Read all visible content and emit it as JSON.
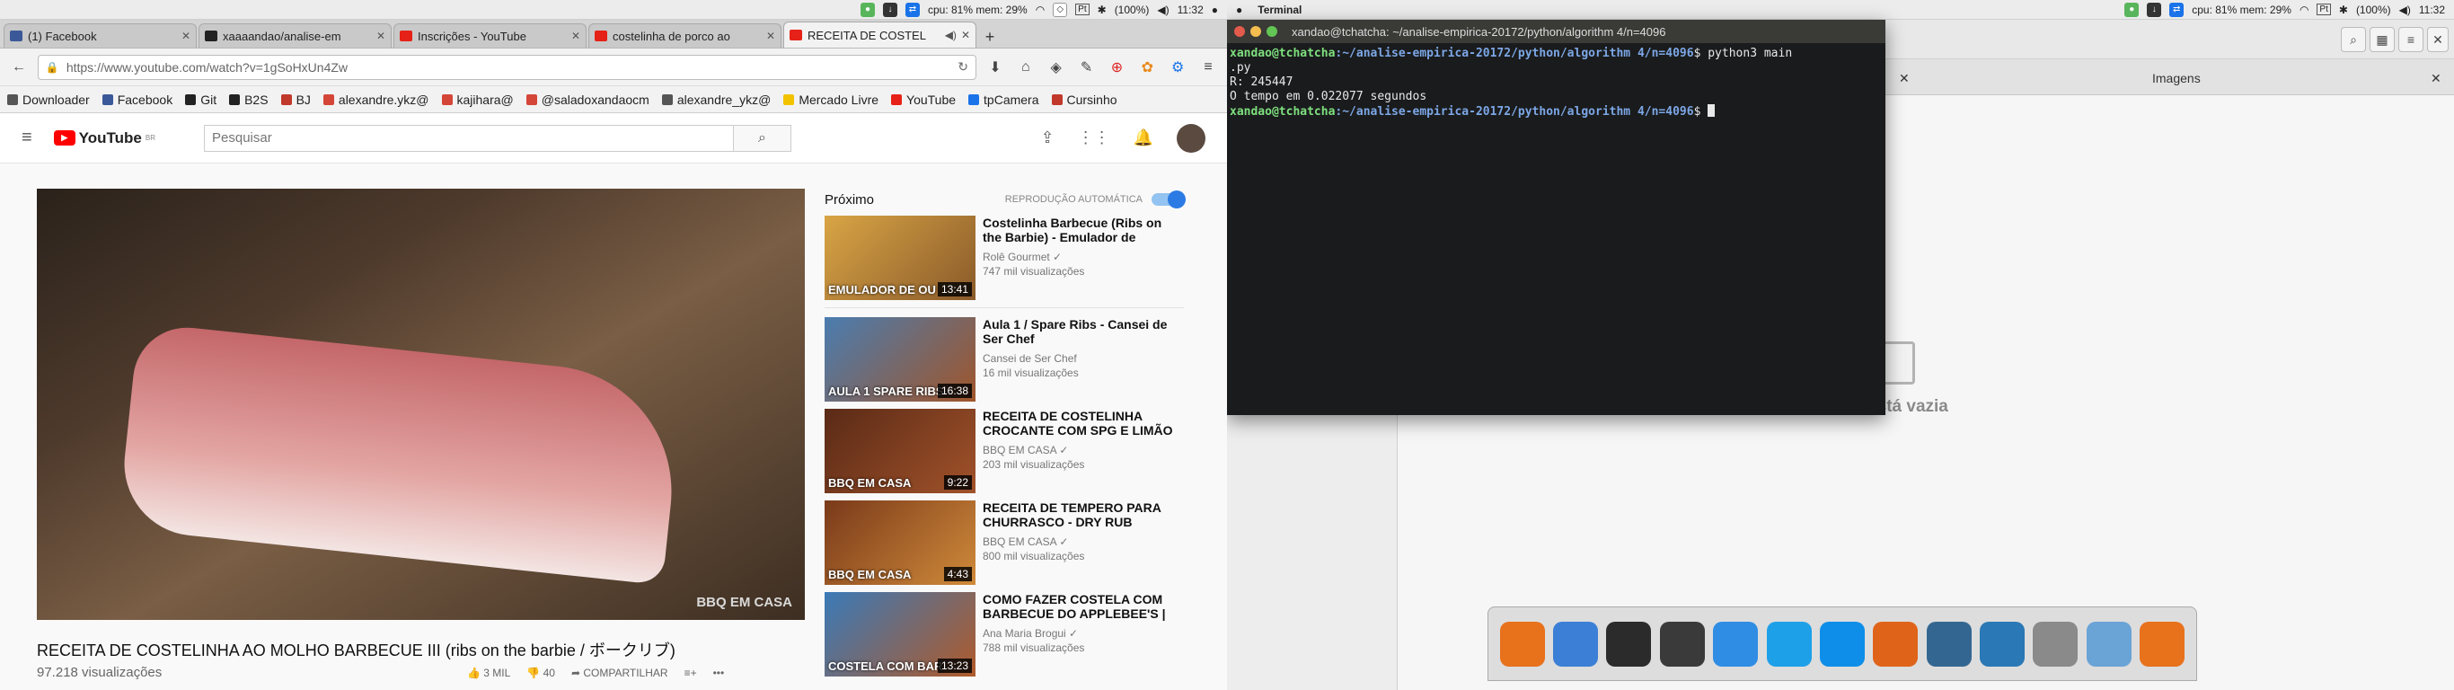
{
  "left": {
    "menubar": {
      "cpu_mem": "cpu: 81% mem: 29%",
      "battery": "(100%)",
      "clock": "11:32"
    },
    "tabs": [
      {
        "label": "(1) Facebook",
        "color": "#3b5998"
      },
      {
        "label": "xaaaandao/analise-em",
        "color": "#222222"
      },
      {
        "label": "Inscrições - YouTube",
        "color": "#e62117"
      },
      {
        "label": "costelinha de porco ao",
        "color": "#e62117"
      },
      {
        "label": "RECEITA DE COSTEL",
        "color": "#e62117"
      }
    ],
    "url": "https://www.youtube.com/watch?v=1gSoHxUn4Zw",
    "bookmarks": [
      {
        "label": "Downloader",
        "color": "#555555"
      },
      {
        "label": "Facebook",
        "color": "#3b5998"
      },
      {
        "label": "Git",
        "color": "#222222"
      },
      {
        "label": "B2S",
        "color": "#222222"
      },
      {
        "label": "BJ",
        "color": "#c0392b"
      },
      {
        "label": "alexandre.ykz@",
        "color": "#d44638"
      },
      {
        "label": "kajihara@",
        "color": "#d44638"
      },
      {
        "label": "@saladoxandaocm",
        "color": "#d44638"
      },
      {
        "label": "alexandre_ykz@",
        "color": "#555555"
      },
      {
        "label": "Mercado Livre",
        "color": "#f2c200"
      },
      {
        "label": "YouTube",
        "color": "#e62117"
      },
      {
        "label": "tpCamera",
        "color": "#1a73e8"
      },
      {
        "label": "Cursinho",
        "color": "#c0392b"
      }
    ],
    "youtube": {
      "search_placeholder": "Pesquisar",
      "video_title": "RECEITA DE COSTELINHA AO MOLHO BARBECUE III (ribs on the barbie / ボークリブ)",
      "views": "97.218 visualizações",
      "watermark": "BBQ EM CASA",
      "likes": "3 MIL",
      "dislikes": "40",
      "share": "COMPARTILHAR",
      "up_next": "Próximo",
      "autoplay": "REPRODUÇÃO AUTOMÁTICA",
      "related": [
        {
          "title": "Costelinha Barbecue (Ribs on the Barbie) - Emulador de",
          "channel": "Rolê Gourmet ✓",
          "views": "747 mil visualizações",
          "duration": "13:41",
          "thumb_text": "EMULADOR DE OU",
          "c1": "#d9a545",
          "c2": "#8a5a2a"
        },
        {
          "title": "Aula 1 / Spare Ribs - Cansei de Ser Chef",
          "channel": "Cansei de Ser Chef",
          "views": "16 mil visualizações",
          "duration": "16:38",
          "thumb_text": "AULA 1 SPARE RIBS",
          "c1": "#4a7db0",
          "c2": "#a0552a"
        },
        {
          "title": "RECEITA DE COSTELINHA CROCANTE COM SPG E LIMÃO",
          "channel": "BBQ EM CASA ✓",
          "views": "203 mil visualizações",
          "duration": "9:22",
          "thumb_text": "BBQ EM CASA",
          "c1": "#5a2a16",
          "c2": "#a1522a"
        },
        {
          "title": "RECEITA DE TEMPERO PARA CHURRASCO - DRY RUB",
          "channel": "BBQ EM CASA ✓",
          "views": "800 mil visualizações",
          "duration": "4:43",
          "thumb_text": "BBQ EM CASA",
          "c1": "#7a3a1a",
          "c2": "#d08a3a"
        },
        {
          "title": "COMO FAZER COSTELA COM BARBECUE DO APPLEBEE'S |",
          "channel": "Ana Maria Brogui ✓",
          "views": "788 mil visualizações",
          "duration": "13:23",
          "thumb_text": "COSTELA COM BAR",
          "c1": "#3a7ab8",
          "c2": "#b05a2a"
        }
      ]
    }
  },
  "right": {
    "menubar": {
      "app": "Terminal",
      "cpu_mem": "cpu: 81% mem: 29%",
      "battery": "(100%)",
      "clock": "11:32"
    },
    "terminal": {
      "title": "xandao@tchatcha: ~/analise-empirica-20172/python/algorithm 4/n=4096",
      "user_host": "xandao@tchatcha",
      "path": ":~/analise-empirica-20172/python/algorithm 4/n=4096",
      "command": "$ python3 main",
      "command_wrap": ".py",
      "output": [
        "R: 245447",
        "O tempo em 0.022077 segundos"
      ]
    },
    "filemanager": {
      "tab": "Imagens",
      "empty_label": "Pasta está vazia"
    },
    "dock": [
      {
        "name": "firefox-icon",
        "color": "#e8711c"
      },
      {
        "name": "finder-icon",
        "color": "#3b7fd6"
      },
      {
        "name": "terminal-icon",
        "color": "#2b2b2b"
      },
      {
        "name": "code-editor-icon",
        "color": "#3a3a3a"
      },
      {
        "name": "dropbox-icon",
        "color": "#2f8de4"
      },
      {
        "name": "skype-icon",
        "color": "#1ea0e8"
      },
      {
        "name": "teamviewer-icon",
        "color": "#0e8ee9"
      },
      {
        "name": "matlab-icon",
        "color": "#e0631a"
      },
      {
        "name": "postgres-icon",
        "color": "#336791"
      },
      {
        "name": "mysql-workbench-icon",
        "color": "#2a78b5"
      },
      {
        "name": "disk-utility-icon",
        "color": "#8a8a8a"
      },
      {
        "name": "virtualbox-icon",
        "color": "#6aa3d6"
      },
      {
        "name": "ubuntu-software-icon",
        "color": "#e8711c"
      }
    ]
  }
}
